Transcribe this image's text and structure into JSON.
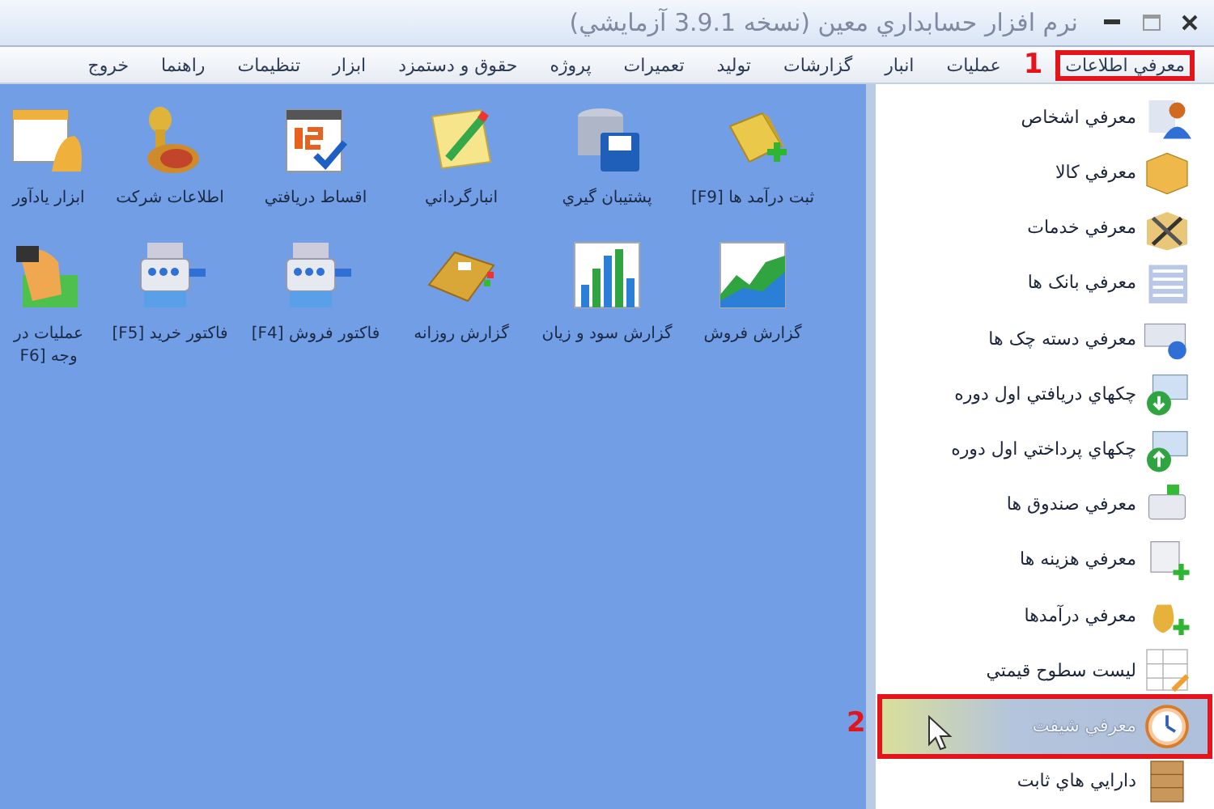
{
  "window": {
    "title": "نرم افزار حسابداري معين (نسخه 3.9.1 آزمايشي)"
  },
  "menu": [
    {
      "label": "معرفي اطلاعات",
      "highlighted": true,
      "badge": "1"
    },
    {
      "label": "عمليات",
      "highlighted": false
    },
    {
      "label": "انبار",
      "highlighted": false
    },
    {
      "label": "گزارشات",
      "highlighted": false
    },
    {
      "label": "توليد",
      "highlighted": false
    },
    {
      "label": "تعميرات",
      "highlighted": false
    },
    {
      "label": "پروژه",
      "highlighted": false
    },
    {
      "label": "حقوق و دستمزد",
      "highlighted": false
    },
    {
      "label": "ابزار",
      "highlighted": false
    },
    {
      "label": "تنظيمات",
      "highlighted": false
    },
    {
      "label": "راهنما",
      "highlighted": false
    },
    {
      "label": "خروج",
      "highlighted": false
    }
  ],
  "desktop": [
    {
      "label": "ثبت درآمد ها [F9]"
    },
    {
      "label": "پشتيبان گيري"
    },
    {
      "label": "انبارگرداني"
    },
    {
      "label": "اقساط دريافتي"
    },
    {
      "label": "اطلاعات شركت"
    },
    {
      "label": "ابزار يادآور"
    },
    {
      "label": "گزارش فروش"
    },
    {
      "label": "گزارش سود و زيان"
    },
    {
      "label": "گزارش روزانه"
    },
    {
      "label": "فاكتور فروش [F4]"
    },
    {
      "label": "فاكتور خريد [F5]"
    },
    {
      "label": "عمليات در وجه [F6"
    }
  ],
  "sidebar": [
    {
      "label": "معرفي اشخاص",
      "selected": false
    },
    {
      "label": "معرفي كالا",
      "selected": false
    },
    {
      "label": "معرفي خدمات",
      "selected": false
    },
    {
      "label": "معرفي بانک ها",
      "selected": false
    },
    {
      "label": "معرفي دسته چک ها",
      "selected": false
    },
    {
      "label": "چکهاي دريافتي اول دوره",
      "selected": false
    },
    {
      "label": "چکهاي پرداختي اول دوره",
      "selected": false
    },
    {
      "label": "معرفي صندوق ها",
      "selected": false
    },
    {
      "label": "معرفي هزينه ها",
      "selected": false
    },
    {
      "label": "معرفي درآمدها",
      "selected": false
    },
    {
      "label": "ليست سطوح قيمتي",
      "selected": false
    },
    {
      "label": "معرفي شيفت",
      "selected": true,
      "badge": "2"
    },
    {
      "label": "دارايي هاي ثابت",
      "selected": false
    }
  ]
}
